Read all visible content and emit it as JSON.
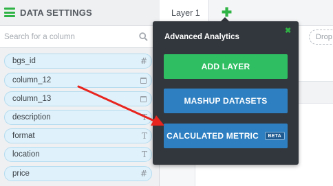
{
  "panel": {
    "title": "DATA SETTINGS",
    "search_placeholder": "Search for a column",
    "columns": [
      {
        "name": "bgs_id",
        "type_icon": "#"
      },
      {
        "name": "column_12",
        "type_icon": "calendar"
      },
      {
        "name": "column_13",
        "type_icon": "calendar"
      },
      {
        "name": "description",
        "type_icon": "T"
      },
      {
        "name": "format",
        "type_icon": "T"
      },
      {
        "name": "location",
        "type_icon": "T"
      },
      {
        "name": "price",
        "type_icon": "#"
      }
    ]
  },
  "tabs": {
    "layer_label": "Layer 1",
    "add_label": "✚"
  },
  "filters": {
    "label": "s:",
    "drop_text": "Drop"
  },
  "popover": {
    "title": "Advanced Analytics",
    "close_label": "✖",
    "buttons": {
      "add_layer": "ADD LAYER",
      "mashup": "MASHUP DATASETS",
      "calculated": "CALCULATED METRIC",
      "beta": "BETA"
    }
  },
  "colors": {
    "accent_green": "#2fb344",
    "button_blue": "#2d7fc1",
    "arrow_red": "#e8251f"
  }
}
